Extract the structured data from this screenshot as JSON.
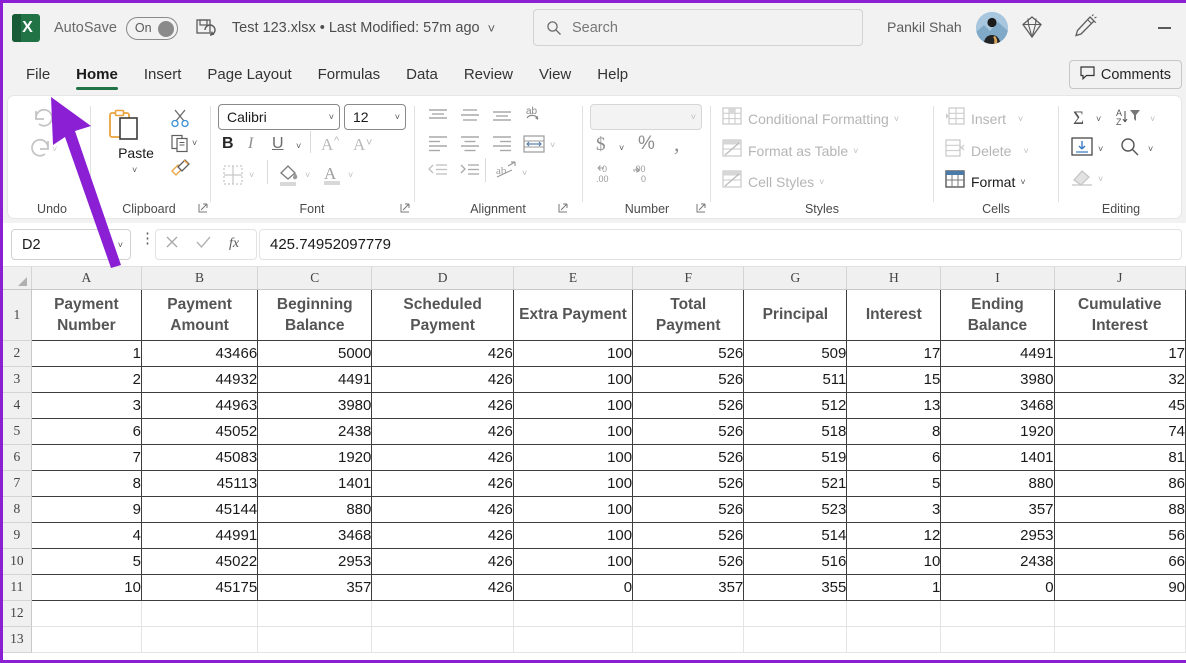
{
  "titlebar": {
    "app_icon": "excel-logo",
    "autosave_label": "AutoSave",
    "autosave_state": "On",
    "save_icon": "save-refresh-icon",
    "document_title": "Test 123.xlsx • Last Modified: 57m ago",
    "title_chevron": "chevron-down-icon",
    "search_placeholder": "Search",
    "search_icon": "search-icon",
    "user_name": "Pankil Shah",
    "avatar": "user-avatar",
    "diamond_icon": "diamond-icon",
    "pen_icon": "pen-highlighter-icon",
    "minimize_label": "Minimize"
  },
  "tabs": [
    {
      "label": "File",
      "active": false
    },
    {
      "label": "Home",
      "active": true
    },
    {
      "label": "Insert",
      "active": false
    },
    {
      "label": "Page Layout",
      "active": false
    },
    {
      "label": "Formulas",
      "active": false
    },
    {
      "label": "Data",
      "active": false
    },
    {
      "label": "Review",
      "active": false
    },
    {
      "label": "View",
      "active": false
    },
    {
      "label": "Help",
      "active": false
    }
  ],
  "comments_button": {
    "label": "Comments",
    "icon": "comment-icon"
  },
  "ribbon": {
    "groups": [
      {
        "name": "undo",
        "label": "Undo"
      },
      {
        "name": "clipboard",
        "label": "Clipboard"
      },
      {
        "name": "font",
        "label": "Font"
      },
      {
        "name": "alignment",
        "label": "Alignment"
      },
      {
        "name": "number",
        "label": "Number"
      },
      {
        "name": "styles",
        "label": "Styles"
      },
      {
        "name": "cells",
        "label": "Cells"
      },
      {
        "name": "editing",
        "label": "Editing"
      }
    ],
    "clipboard": {
      "paste_label": "Paste"
    },
    "font": {
      "font_family": "Calibri",
      "font_size": "12",
      "bold": "B",
      "italic": "I",
      "underline": "U"
    },
    "number": {
      "format_value": "",
      "currency": "$",
      "percent": "%",
      "comma": ","
    },
    "styles": {
      "conditional_formatting": "Conditional Formatting",
      "format_as_table": "Format as Table",
      "cell_styles": "Cell Styles"
    },
    "cells": {
      "insert": "Insert",
      "delete": "Delete",
      "format": "Format"
    }
  },
  "formula_bar": {
    "name_box_value": "D2",
    "cancel_icon": "cancel-x-icon",
    "enter_icon": "confirm-check-icon",
    "function_icon": "fx-icon",
    "formula_value": "425.74952097779"
  },
  "sheet": {
    "column_letters": [
      "A",
      "B",
      "C",
      "D",
      "E",
      "F",
      "G",
      "H",
      "I",
      "J"
    ],
    "row_numbers": [
      "1",
      "2",
      "3",
      "4",
      "5",
      "6",
      "7",
      "8",
      "9",
      "10",
      "11",
      "12",
      "13"
    ],
    "headers": [
      "Payment Number",
      "Payment Amount",
      "Beginning Balance",
      "Scheduled Payment",
      "Extra Payment",
      "Total Payment",
      "Principal",
      "Interest",
      "Ending Balance",
      "Cumulative Interest"
    ],
    "rows": [
      [
        "1",
        "43466",
        "5000",
        "426",
        "100",
        "526",
        "509",
        "17",
        "4491",
        "17"
      ],
      [
        "2",
        "44932",
        "4491",
        "426",
        "100",
        "526",
        "511",
        "15",
        "3980",
        "32"
      ],
      [
        "3",
        "44963",
        "3980",
        "426",
        "100",
        "526",
        "512",
        "13",
        "3468",
        "45"
      ],
      [
        "6",
        "45052",
        "2438",
        "426",
        "100",
        "526",
        "518",
        "8",
        "1920",
        "74"
      ],
      [
        "7",
        "45083",
        "1920",
        "426",
        "100",
        "526",
        "519",
        "6",
        "1401",
        "81"
      ],
      [
        "8",
        "45113",
        "1401",
        "426",
        "100",
        "526",
        "521",
        "5",
        "880",
        "86"
      ],
      [
        "9",
        "45144",
        "880",
        "426",
        "100",
        "526",
        "523",
        "3",
        "357",
        "88"
      ],
      [
        "4",
        "44991",
        "3468",
        "426",
        "100",
        "526",
        "514",
        "12",
        "2953",
        "56"
      ],
      [
        "5",
        "45022",
        "2953",
        "426",
        "100",
        "526",
        "516",
        "10",
        "2438",
        "66"
      ],
      [
        "10",
        "45175",
        "357",
        "426",
        "0",
        "357",
        "355",
        "1",
        "0",
        "90"
      ]
    ],
    "empty_rows": 2
  },
  "annotation": {
    "arrow_color": "#8b1fd4",
    "border_color": "#8b1fd4"
  }
}
